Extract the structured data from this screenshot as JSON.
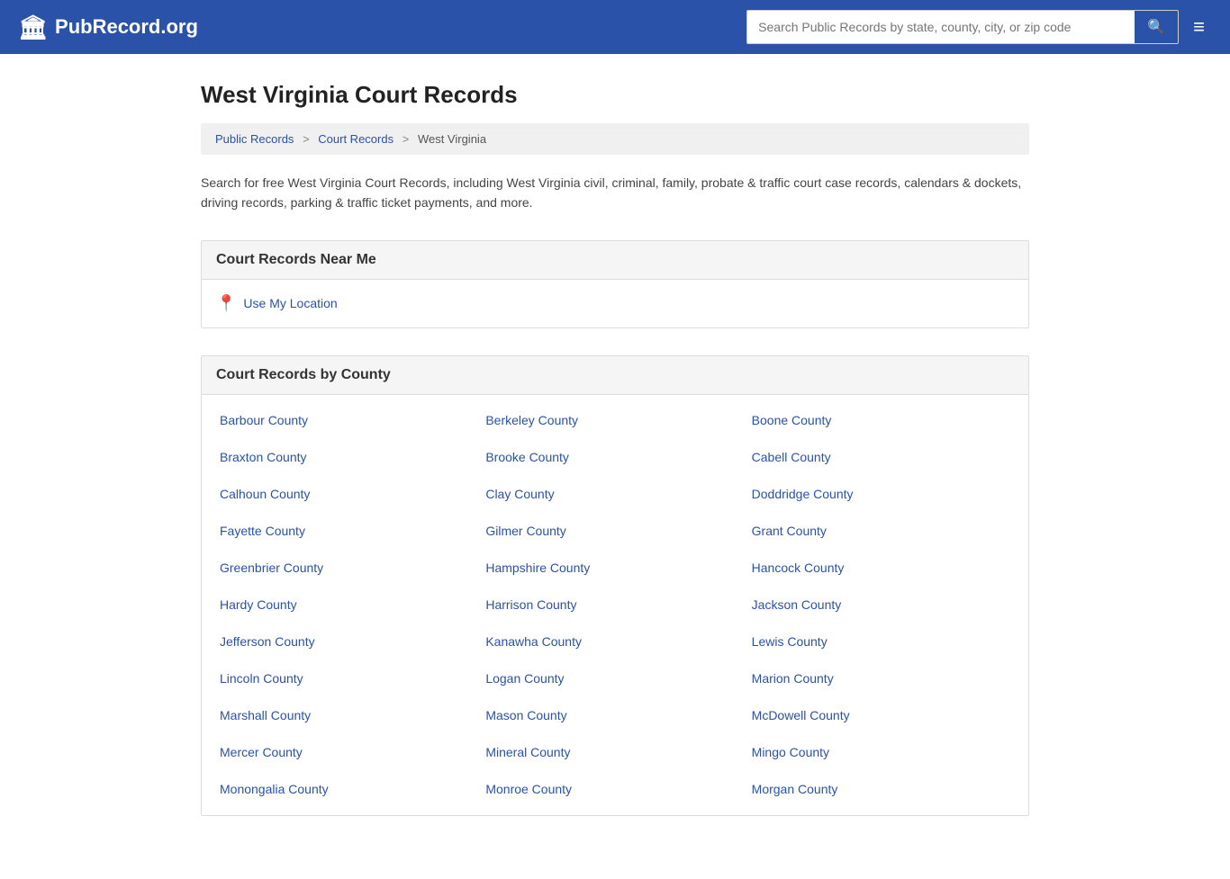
{
  "header": {
    "logo_icon": "🏛",
    "logo_text": "PubRecord.org",
    "search_placeholder": "Search Public Records by state, county, city, or zip code",
    "search_icon": "🔍",
    "menu_icon": "≡"
  },
  "breadcrumb": {
    "items": [
      "Public Records",
      "Court Records",
      "West Virginia"
    ]
  },
  "page": {
    "title": "West Virginia Court Records",
    "description": "Search for free West Virginia Court Records, including West Virginia civil, criminal, family, probate & traffic court case records, calendars & dockets, driving records, parking & traffic ticket payments, and more."
  },
  "near_me": {
    "section_title": "Court Records Near Me",
    "use_location_label": "Use My Location",
    "location_icon": "📍"
  },
  "by_county": {
    "section_title": "Court Records by County",
    "counties": [
      "Barbour County",
      "Berkeley County",
      "Boone County",
      "Braxton County",
      "Brooke County",
      "Cabell County",
      "Calhoun County",
      "Clay County",
      "Doddridge County",
      "Fayette County",
      "Gilmer County",
      "Grant County",
      "Greenbrier County",
      "Hampshire County",
      "Hancock County",
      "Hardy County",
      "Harrison County",
      "Jackson County",
      "Jefferson County",
      "Kanawha County",
      "Lewis County",
      "Lincoln County",
      "Logan County",
      "Marion County",
      "Marshall County",
      "Mason County",
      "McDowell County",
      "Mercer County",
      "Mineral County",
      "Mingo County",
      "Monongalia County",
      "Monroe County",
      "Morgan County"
    ]
  }
}
